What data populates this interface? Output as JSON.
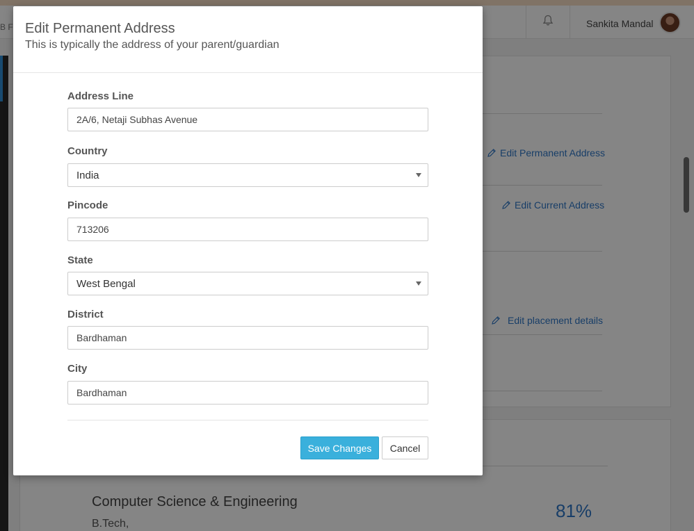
{
  "app": {
    "brand_fragment": "B F",
    "user_name": "Sankita Mandal"
  },
  "background": {
    "edit_permanent_address": "Edit Permanent Address",
    "edit_current_address": "Edit Current Address",
    "edit_placement_details": "Edit placement details",
    "education": {
      "course": "Computer Science & Engineering",
      "degree": "B.Tech,",
      "percentage": "81%"
    }
  },
  "modal": {
    "title": "Edit Permanent Address",
    "subtitle": "This is typically the address of your parent/guardian",
    "fields": {
      "address_line": {
        "label": "Address Line",
        "value": "2A/6, Netaji Subhas Avenue"
      },
      "country": {
        "label": "Country",
        "value": "India"
      },
      "pincode": {
        "label": "Pincode",
        "value": "713206"
      },
      "state": {
        "label": "State",
        "value": "West Bengal"
      },
      "district": {
        "label": "District",
        "value": "Bardhaman"
      },
      "city": {
        "label": "City",
        "value": "Bardhaman"
      }
    },
    "buttons": {
      "save": "Save Changes",
      "cancel": "Cancel"
    }
  },
  "colors": {
    "accent": "#3ab0dc",
    "link": "#2f77c7",
    "overlay": "rgba(0,0,0,0.48)"
  },
  "icons": [
    "bell-icon",
    "pencil-icon",
    "chevron-down-icon",
    "avatar"
  ]
}
